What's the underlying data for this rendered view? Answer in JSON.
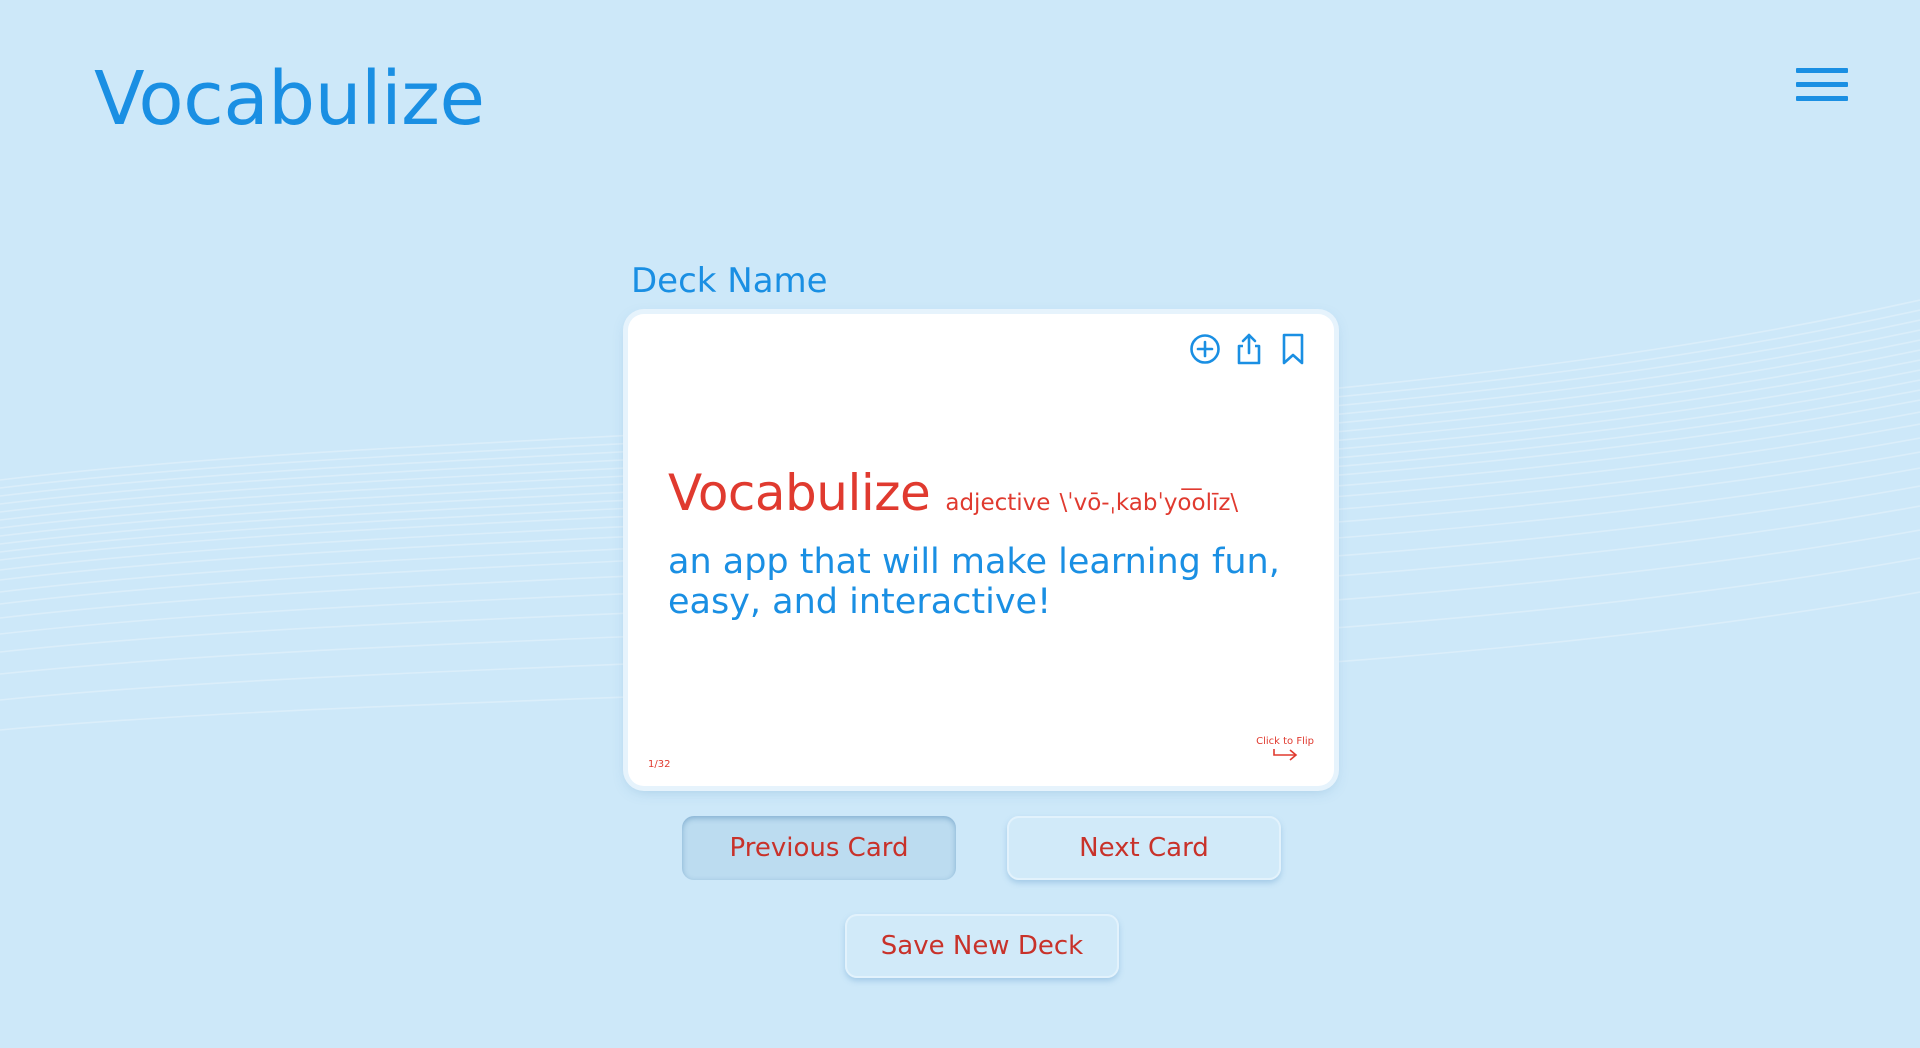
{
  "app": {
    "title": "Vocabulize"
  },
  "header": {
    "menu_icon": "hamburger-menu-icon"
  },
  "deck": {
    "name_label": "Deck Name"
  },
  "card": {
    "word": "Vocabulize",
    "part_of_speech": "adjective",
    "pronunciation": "\\ˈvō-ˌkabˈyo͞olīz\\",
    "definition": "an app that will make learning fun, easy, and interactive!",
    "counter": "1/32",
    "flip_hint": "Click to Flip",
    "actions": {
      "add_icon": "plus-circle-icon",
      "share_icon": "share-icon",
      "bookmark_icon": "bookmark-icon"
    }
  },
  "buttons": {
    "previous": "Previous Card",
    "next": "Next Card",
    "save": "Save New Deck"
  },
  "colors": {
    "background": "#cde8f9",
    "primary_blue": "#1a8fe3",
    "accent_red": "#e03a2f",
    "card": "#ffffff"
  }
}
